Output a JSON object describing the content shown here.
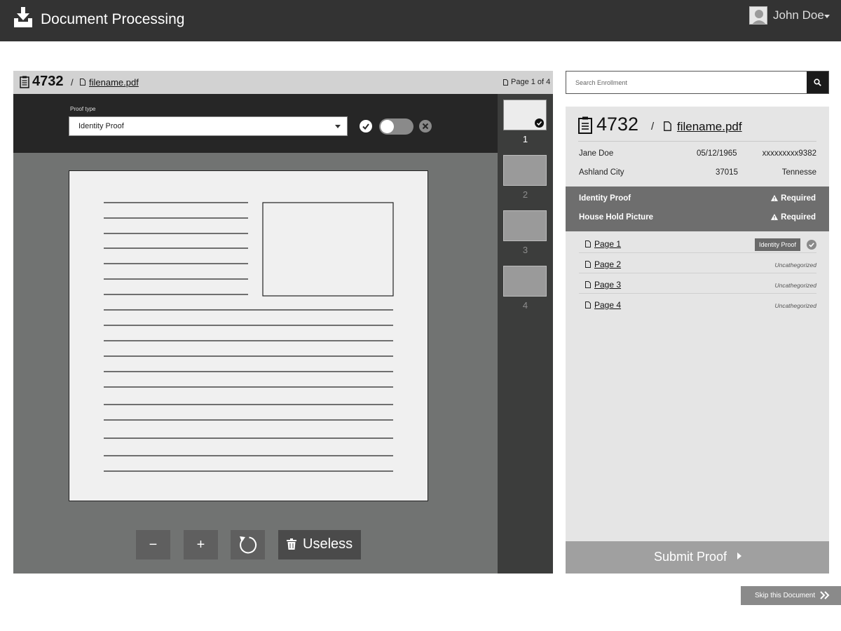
{
  "app": {
    "title": "Document Processing"
  },
  "user": {
    "name": "John Doe"
  },
  "viewer": {
    "doc_id": "4732",
    "path_separator": "/",
    "filename": "filename.pdf",
    "page_count_text": "Page 1 of 4",
    "proof_type_label": "Proof type",
    "proof_type_value": "Identity Proof",
    "toggle_on": false,
    "thumbnails": [
      {
        "number": "1",
        "selected": true,
        "checked": true
      },
      {
        "number": "2",
        "selected": false,
        "checked": false
      },
      {
        "number": "3",
        "selected": false,
        "checked": false
      },
      {
        "number": "4",
        "selected": false,
        "checked": false
      }
    ],
    "controls": {
      "zoom_out": "−",
      "zoom_in": "+",
      "useless": "Useless"
    }
  },
  "search": {
    "placeholder": "Search Enrollment",
    "value": ""
  },
  "enrollment": {
    "doc_id": "4732",
    "path_separator": "/",
    "filename": "filename.pdf",
    "name": "Jane Doe",
    "dob": "05/12/1965",
    "id_masked": "xxxxxxxxx9382",
    "city": "Ashland City",
    "zip": "37015",
    "state": "Tennesse",
    "requirements": [
      {
        "label": "Identity Proof",
        "status": "Required"
      },
      {
        "label": "House Hold Picture",
        "status": "Required"
      }
    ],
    "pages": [
      {
        "label": "Page 1",
        "badge": "Identity Proof",
        "checked": true
      },
      {
        "label": "Page 2",
        "status": "Uncathegorized"
      },
      {
        "label": "Page 3",
        "status": "Uncathegorized"
      },
      {
        "label": "Page 4",
        "status": "Uncathegorized"
      }
    ],
    "submit_label": "Submit Proof"
  },
  "skip": {
    "label": "Skip this Document"
  },
  "colors": {
    "header_bg": "#333333",
    "viewer_bg": "#717372",
    "proof_bar_bg": "#262626",
    "page_strip_bg": "#3c3d3c",
    "requirements_bg": "#6e6e6e",
    "panel_bg": "#e5e5e5"
  },
  "icons": {
    "app_logo": "inbox-download-icon",
    "clipboard": "clipboard-icon",
    "file": "file-icon",
    "search": "search-icon",
    "approve": "check-circle-icon",
    "reject": "x-circle-icon",
    "rotate": "rotate-icon",
    "trash": "trash-icon",
    "warning": "warning-icon",
    "share": "share-arrow-icon",
    "skip": "double-chevron-right-icon"
  }
}
